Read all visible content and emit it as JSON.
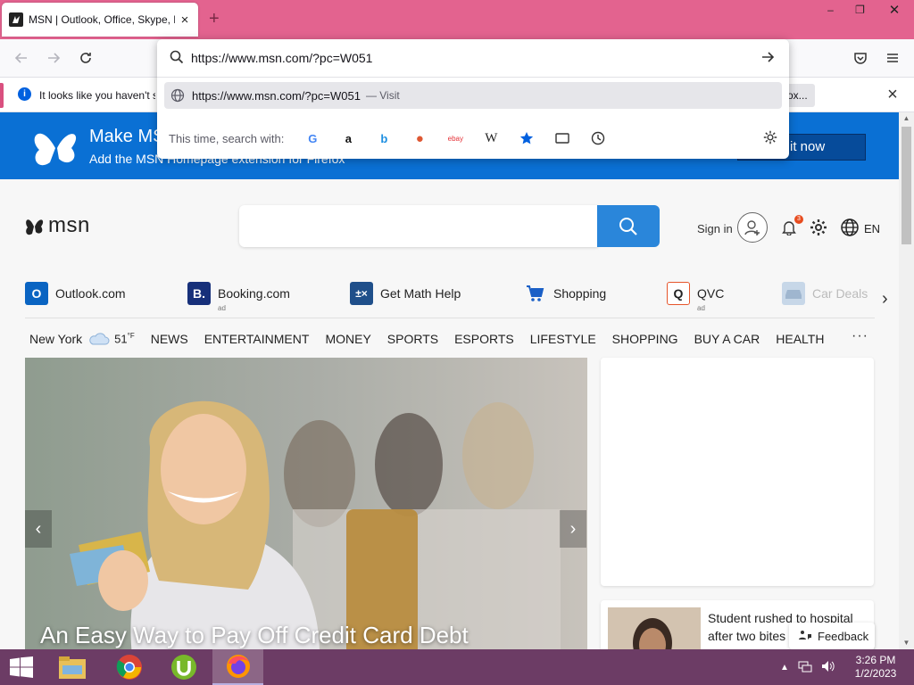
{
  "tab": {
    "title": "MSN | Outlook, Office, Skype, Bing",
    "close": "×"
  },
  "window_controls": {
    "minimize": "–",
    "restore": "❐",
    "close": "✕"
  },
  "newtab_label": "+",
  "url_bar": {
    "value": "https://www.msn.com/?pc=W051",
    "suggestion_url": "https://www.msn.com/?pc=W051",
    "suggestion_action": "— Visit",
    "oneoff_label": "This time, search with:",
    "engines": [
      {
        "name": "google",
        "glyph": "G",
        "color": "#4285f4"
      },
      {
        "name": "amazon",
        "glyph": "a",
        "color": "#111111"
      },
      {
        "name": "bing",
        "glyph": "b",
        "color": "#1d8fe1"
      },
      {
        "name": "duckduckgo",
        "glyph": "●",
        "color": "#de5833"
      },
      {
        "name": "ebay",
        "glyph": "ebay",
        "color": "#e53238"
      },
      {
        "name": "wikipedia",
        "glyph": "W",
        "color": "#222222"
      }
    ]
  },
  "infobar": {
    "text": "It looks like you haven't s",
    "action": "ox..."
  },
  "banner": {
    "title": "Make MSN",
    "subtitle": "Add the MSN Homepage extension for Firefox",
    "cta": "it now"
  },
  "header": {
    "logo_text": "msn",
    "sign_in": "Sign in",
    "notification_count": "3",
    "lang": "EN"
  },
  "quicklinks": [
    {
      "label": "Outlook.com",
      "ad": ""
    },
    {
      "label": "Booking.com",
      "ad": "ad"
    },
    {
      "label": "Get Math Help",
      "ad": ""
    },
    {
      "label": "Shopping",
      "ad": ""
    },
    {
      "label": "QVC",
      "ad": "ad"
    },
    {
      "label": "Car Deals",
      "ad": ""
    }
  ],
  "nav": {
    "city": "New York",
    "temp": "51",
    "unit": "°F",
    "links": [
      "NEWS",
      "ENTERTAINMENT",
      "MONEY",
      "SPORTS",
      "ESPORTS",
      "LIFESTYLE",
      "SHOPPING",
      "BUY A CAR",
      "HEALTH"
    ],
    "more": "···"
  },
  "hero": {
    "title": "An Easy Way to Pay Off Credit Card Debt",
    "prev": "‹",
    "next": "›"
  },
  "news": {
    "headline": "Student rushed to hospital after two bites"
  },
  "feedback": "Feedback",
  "taskbar": {
    "time": "3:26 PM",
    "date": "1/2/2023"
  },
  "colors": {
    "tabstrip": "#e3638f",
    "banner": "#0a70d4",
    "search_button": "#2a86da",
    "taskbar": "#6c3c65"
  }
}
